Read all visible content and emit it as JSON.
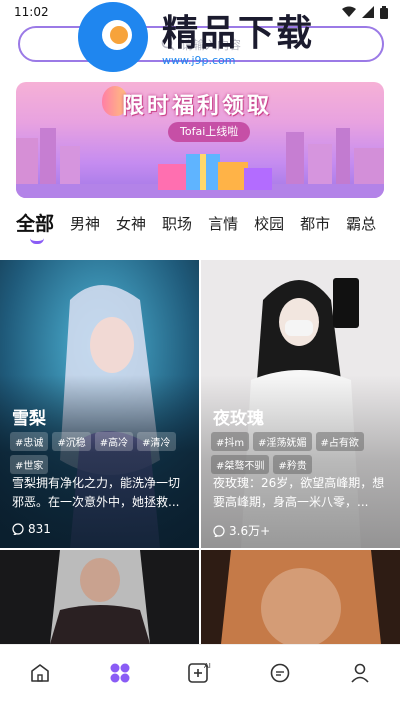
{
  "status_bar": {
    "time": "11:02"
  },
  "search": {
    "placeholder": "请输入内容"
  },
  "watermark": {
    "brand": "精品下载",
    "url": "www.j9p.com"
  },
  "banner": {
    "title": "限时福利领取",
    "subtitle": "Tofai上线啦"
  },
  "tabs": [
    {
      "label": "全部",
      "active": true
    },
    {
      "label": "男神"
    },
    {
      "label": "女神"
    },
    {
      "label": "职场"
    },
    {
      "label": "言情"
    },
    {
      "label": "校园"
    },
    {
      "label": "都市"
    },
    {
      "label": "霸总"
    }
  ],
  "cards": [
    {
      "name": "雪梨",
      "tags": [
        "#忠诚",
        "#沉稳",
        "#高冷",
        "#清冷",
        "#世家"
      ],
      "description": "雪梨拥有净化之力，能洗净一切邪恶。在一次意外中，她拯救...",
      "count": "831"
    },
    {
      "name": "夜玫瑰",
      "tags": [
        "#抖m",
        "#淫荡妩媚",
        "#占有欲",
        "#桀骜不驯",
        "#矜贵"
      ],
      "description": "夜玫瑰：26岁，欲望高峰期，想要高峰期，身高一米八零，...",
      "count": "3.6万+"
    },
    {
      "name": "",
      "tags": [],
      "description": "",
      "count": ""
    },
    {
      "name": "",
      "tags": [],
      "description": "",
      "count": ""
    }
  ],
  "bottom_nav": {
    "items": [
      {
        "icon": "home-icon"
      },
      {
        "icon": "grid-icon",
        "active": true
      },
      {
        "icon": "ai-create-icon",
        "badge": "AI"
      },
      {
        "icon": "chat-icon"
      },
      {
        "icon": "profile-icon"
      }
    ]
  },
  "colors": {
    "accent": "#8a5cf5",
    "search_border": "#9b7ae6"
  }
}
